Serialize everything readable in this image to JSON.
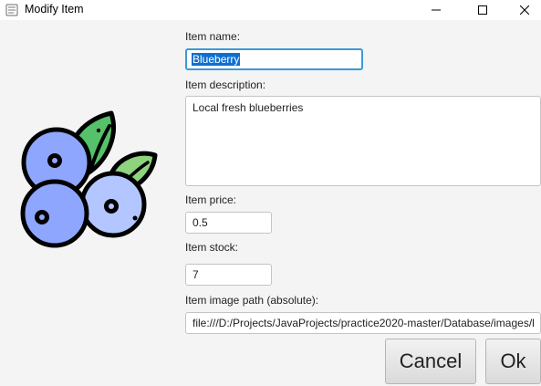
{
  "window": {
    "title": "Modify Item",
    "controls": {
      "minimize_icon": "minimize-icon",
      "maximize_icon": "maximize-icon",
      "close_icon": "close-icon"
    }
  },
  "image": {
    "icon": "blueberry-icon",
    "colors": {
      "berry": "#8fa6ff",
      "berry_light": "#b3c6ff",
      "leaf": "#55c16a",
      "outline": "#000000"
    }
  },
  "form": {
    "name": {
      "label": "Item name:",
      "value": "Blueberry"
    },
    "description": {
      "label": "Item description:",
      "value": "Local fresh blueberries"
    },
    "price": {
      "label": "Item price:",
      "value": "0.5"
    },
    "stock": {
      "label": "Item stock:",
      "value": "7"
    },
    "image_path": {
      "label": "Item image path (absolute):",
      "value": "file:///D:/Projects/JavaProjects/practice2020-master/Database/images/l"
    }
  },
  "buttons": {
    "cancel": "Cancel",
    "ok": "Ok"
  },
  "colors": {
    "focus": "#3a9ad9",
    "selection": "#0f6fd0"
  }
}
